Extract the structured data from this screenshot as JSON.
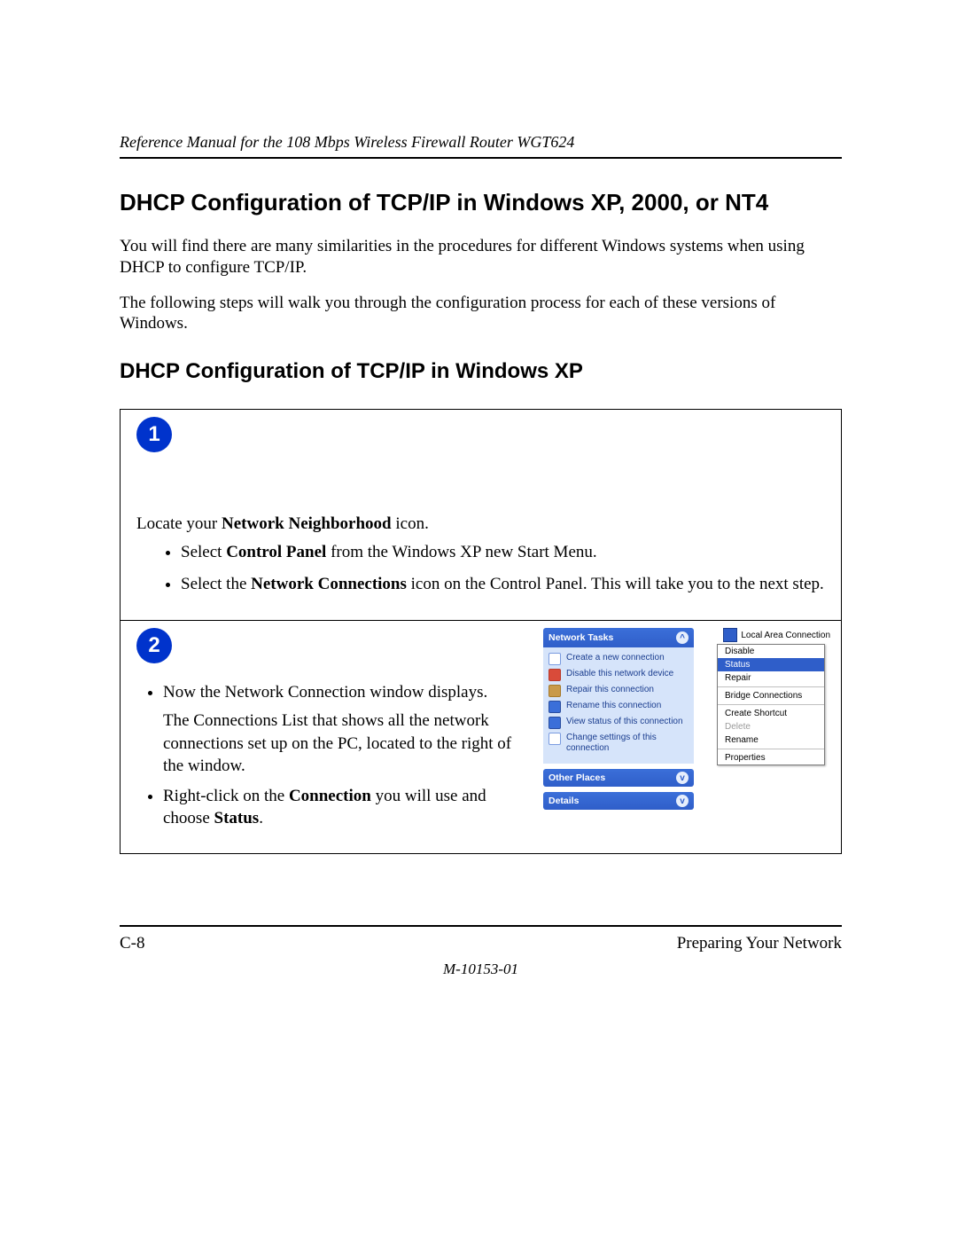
{
  "header": {
    "running_title": "Reference Manual for the 108 Mbps Wireless Firewall Router WGT624"
  },
  "section": {
    "heading": "DHCP Configuration of TCP/IP in Windows XP, 2000, or NT4",
    "para1": "You will find there are many similarities in the procedures for different Windows systems when using DHCP to configure TCP/IP.",
    "para2": "The following steps will walk you through the configuration process for each of these versions of Windows.",
    "sub_heading": "DHCP Configuration of TCP/IP in Windows XP"
  },
  "steps": {
    "one": {
      "badge": "1",
      "intro_pre": "Locate your ",
      "intro_bold": "Network Neighborhood",
      "intro_post": " icon.",
      "b1_pre": "Select ",
      "b1_bold": "Control Panel",
      "b1_post": " from the Windows XP new Start Menu.",
      "b2_pre": "Select the ",
      "b2_bold": "Network Connections",
      "b2_post": " icon on the Control Panel.  This will take you to the next step."
    },
    "two": {
      "badge": "2",
      "b1": "Now the Network Connection window displays.",
      "b1_detail": "The Connections List that shows all the network connections set up on the PC, located to the right of the window.",
      "b2_pre": "Right-click on the ",
      "b2_bold1": "Connection",
      "b2_mid": " you will use and choose ",
      "b2_bold2": "Status",
      "b2_post": "."
    }
  },
  "tasks_panel": {
    "title": "Network Tasks",
    "items": [
      "Create a new connection",
      "Disable this network device",
      "Repair this connection",
      "Rename this connection",
      "View status of this connection",
      "Change settings of this connection"
    ],
    "other_places": "Other Places",
    "details": "Details"
  },
  "connection": {
    "label": "Local Area Connection"
  },
  "context_menu": {
    "items": [
      "Disable",
      "Status",
      "Repair",
      "Bridge Connections",
      "Create Shortcut",
      "Delete",
      "Rename",
      "Properties"
    ],
    "selected": "Status",
    "disabled": [
      "Delete"
    ]
  },
  "footer": {
    "page_num": "C-8",
    "section_name": "Preparing Your Network",
    "doc_id": "M-10153-01"
  }
}
